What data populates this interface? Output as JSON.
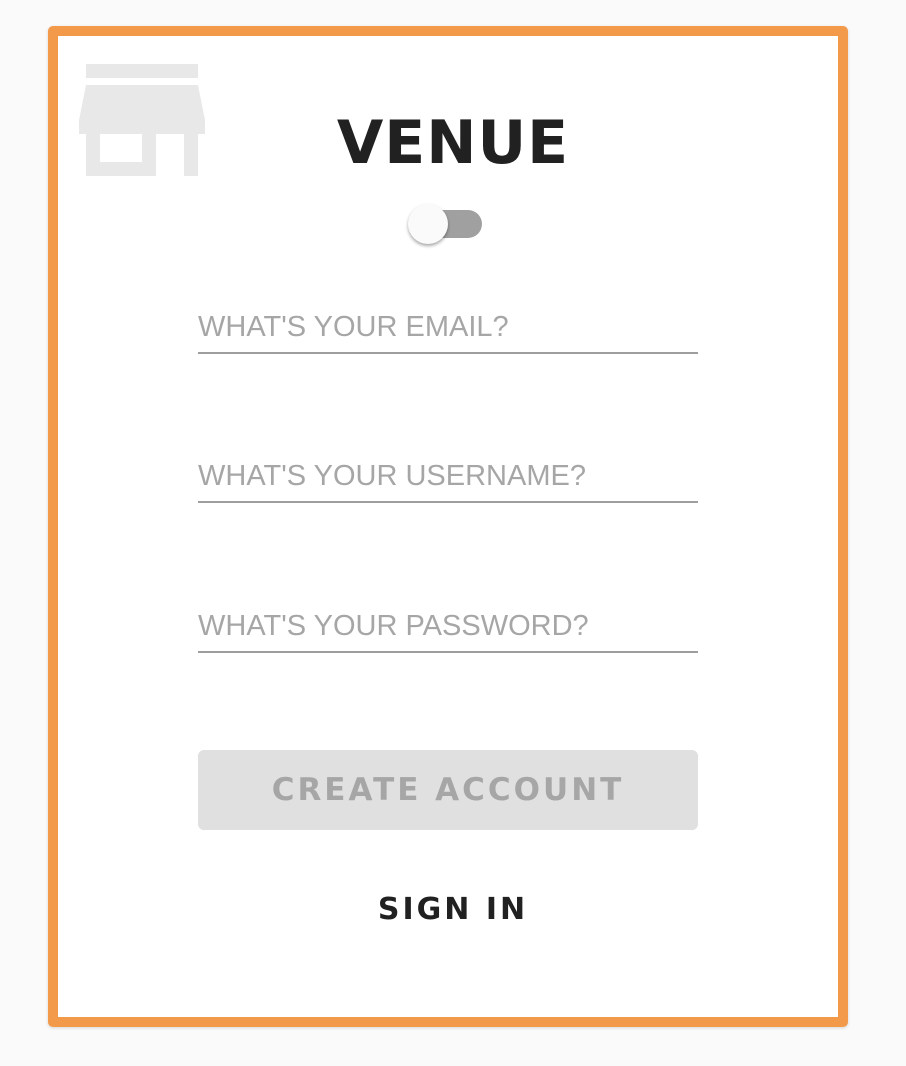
{
  "app": {
    "title": "VENUE",
    "logo_icon": "store-icon",
    "accent_color": "#f29a4a"
  },
  "mode_toggle": {
    "on": false
  },
  "form": {
    "email_placeholder": "WHAT'S YOUR EMAIL?",
    "username_placeholder": "WHAT'S YOUR USERNAME?",
    "password_placeholder": "WHAT'S YOUR PASSWORD?",
    "email_value": "",
    "username_value": "",
    "password_value": ""
  },
  "actions": {
    "create_label": "CREATE ACCOUNT",
    "signin_label": "SIGN IN"
  }
}
